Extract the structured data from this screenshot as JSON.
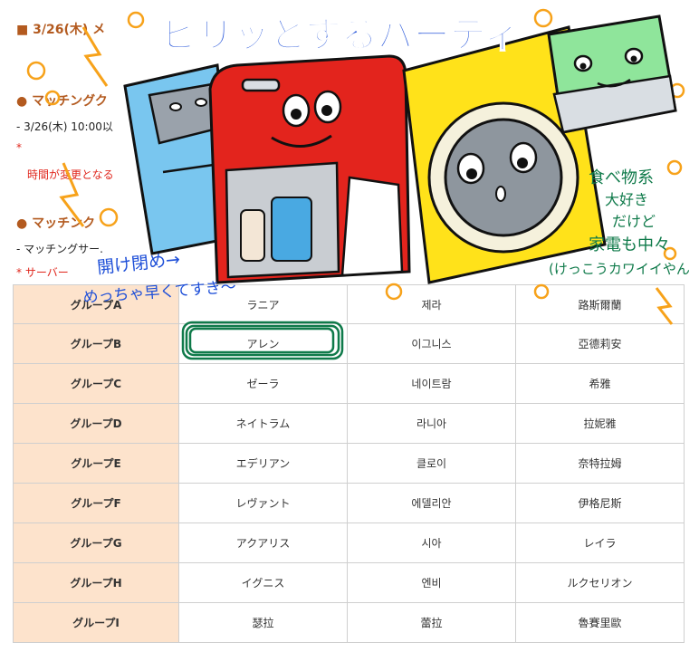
{
  "page": {
    "date_heading": "■ 3/26(木) メ",
    "section1_heading": "● マッチングク",
    "section1_line": "- 3/26(木) 10:00以",
    "section1_asterisk": "*",
    "section1_note": "時間が変更となる",
    "section2_heading": "● マッチンク",
    "section2_line": "- マッチングサー.",
    "section2_note": "* サーバー"
  },
  "table": {
    "rows": [
      {
        "group": "グループA",
        "c1": "ラニア",
        "c2": "제라",
        "c3": "路斯爾蘭"
      },
      {
        "group": "グループB",
        "c1": "アレン",
        "c2": "이그니스",
        "c3": "亞德莉安"
      },
      {
        "group": "グループC",
        "c1": "ゼーラ",
        "c2": "네이트람",
        "c3": "希雅"
      },
      {
        "group": "グループD",
        "c1": "ネイトラム",
        "c2": "라니아",
        "c3": "拉妮雅"
      },
      {
        "group": "グループE",
        "c1": "エデリアン",
        "c2": "클로이",
        "c3": "奈特拉姆"
      },
      {
        "group": "グループF",
        "c1": "レヴァント",
        "c2": "에델리안",
        "c3": "伊格尼斯"
      },
      {
        "group": "グループG",
        "c1": "アクアリス",
        "c2": "시아",
        "c3": "レイラ"
      },
      {
        "group": "グループH",
        "c1": "イグニス",
        "c2": "엔비",
        "c3": "ルクセリオン"
      },
      {
        "group": "グループI",
        "c1": "瑟拉",
        "c2": "蕾拉",
        "c3": "魯賽里歐"
      }
    ]
  },
  "art": {
    "title": "ビリッとするパーティ",
    "note_left_1": "開け閉め→",
    "note_left_2": "めっちゃ早くてすき～",
    "note_right_1": "食べ物系",
    "note_right_2": "大好き",
    "note_right_3": "だけど",
    "note_right_4": "家電も中々",
    "note_right_5": "(けっこうカワイイやん"
  },
  "colors": {
    "heading": "#b35a1f",
    "warning": "#e0261c",
    "group_cell_bg": "#fde3cc",
    "highlight_circle": "#0f7a4a",
    "title_blue": "#1e4fd8",
    "fridge_red": "#e3241d",
    "washer_yellow": "#ffe21a",
    "toaster_green": "#8fe59b",
    "cabinet_blue": "#79c6ef",
    "doodle_orange": "#f7a21a"
  }
}
